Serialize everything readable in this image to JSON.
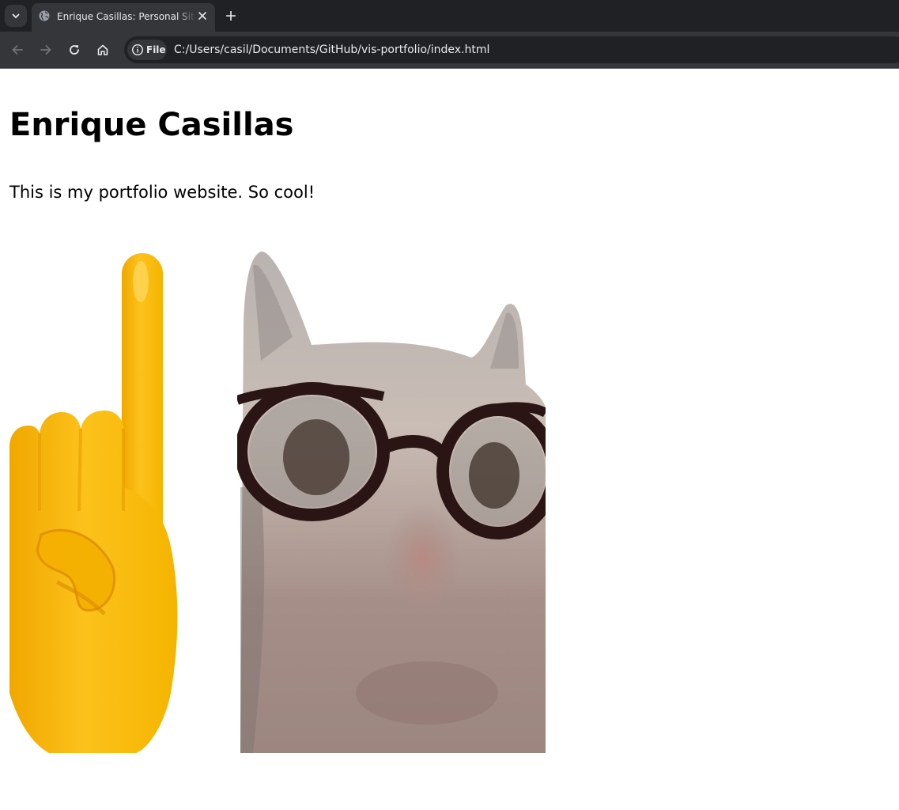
{
  "browser": {
    "tab": {
      "title": "Enrique Casillas: Personal Site and Portfolio"
    },
    "address_bar": {
      "chip_label": "File",
      "url": "C:/Users/casil/Documents/GitHub/vis-portfolio/index.html"
    },
    "icons": {
      "tab_search": "chevron-down-icon",
      "favicon": "globe-icon",
      "close": "close-icon",
      "new_tab": "plus-icon",
      "back": "arrow-left-icon",
      "forward": "arrow-right-icon",
      "reload": "reload-icon",
      "home": "home-icon",
      "info": "info-icon"
    },
    "colors": {
      "tabstrip": "#202124",
      "toolbar": "#35363a",
      "text": "#e8eaed"
    }
  },
  "page": {
    "heading": "Enrique Casillas",
    "paragraph": "This is my portfolio website. So cool!",
    "images": [
      {
        "name": "pointing-up-finger-emoji",
        "dominant_color": "#fcc21b"
      },
      {
        "name": "cat-with-glasses-photo",
        "dominant_color": "#a89a94"
      }
    ]
  }
}
